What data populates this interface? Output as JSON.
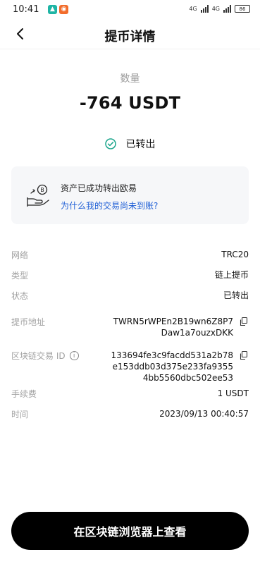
{
  "status_bar": {
    "time": "10:41",
    "network_1": "4G",
    "network_2": "4G",
    "battery": "86"
  },
  "header": {
    "title": "提币详情"
  },
  "summary": {
    "amount_label": "数量",
    "amount_value": "-764 USDT",
    "status_text": "已转出"
  },
  "notice": {
    "title": "资产已成功转出欧易",
    "link": "为什么我的交易尚未到账?"
  },
  "details": {
    "network_label": "网络",
    "network_value": "TRC20",
    "type_label": "类型",
    "type_value": "链上提币",
    "status_label": "状态",
    "status_value": "已转出",
    "address_label": "提币地址",
    "address_line1": "TWRN5rWPEn2B19wn6Z8P7",
    "address_line2": "Daw1a7ouzxDKK",
    "txid_label": "区块链交易 ID",
    "txid_line1": "133694fe3c9facdd531a2b78",
    "txid_line2": "e153ddb03d375e233fa9355",
    "txid_line3": "4bb5560dbc502ee53",
    "fee_label": "手续费",
    "fee_value": "1 USDT",
    "time_label": "时间",
    "time_value": "2023/09/13 00:40:57"
  },
  "footer": {
    "button_label": "在区块链浏览器上查看"
  },
  "colors": {
    "link": "#1f5fd6",
    "success": "#1aa58b",
    "button": "#000000"
  }
}
